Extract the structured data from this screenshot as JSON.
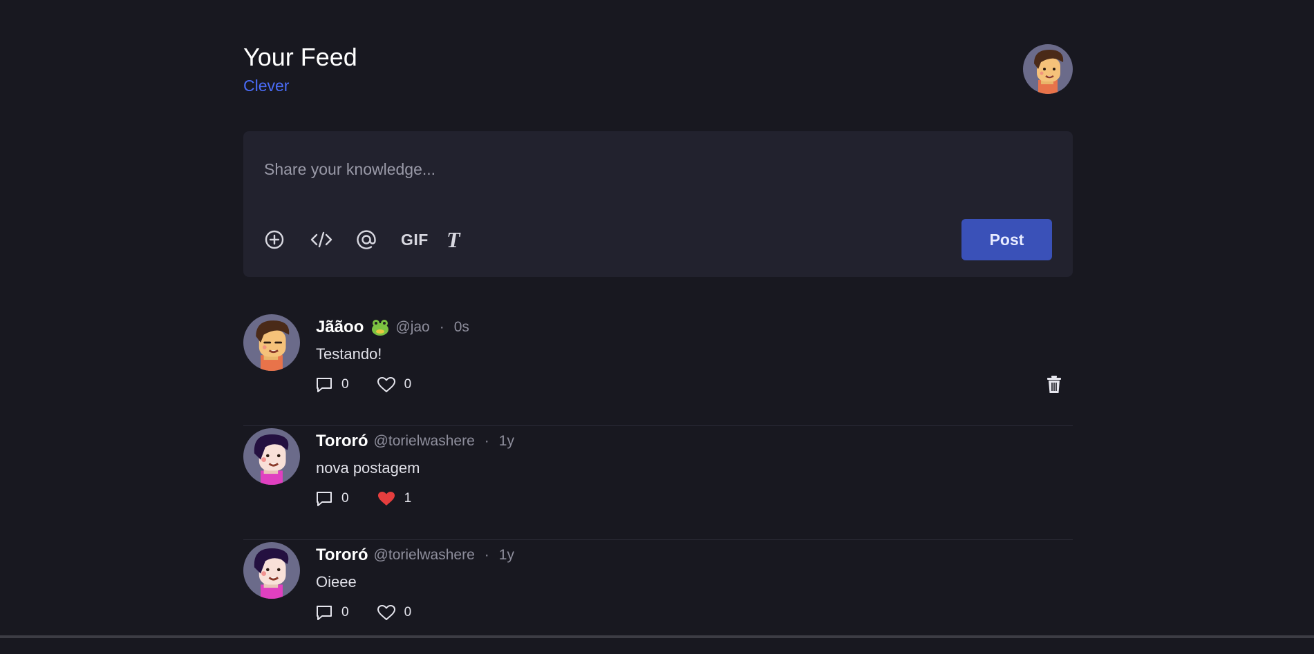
{
  "header": {
    "title": "Your Feed",
    "subtitle": "Clever",
    "avatar": "user-avatar-icon"
  },
  "composer": {
    "placeholder": "Share your knowledge...",
    "tools": [
      {
        "icon": "add-circle-icon"
      },
      {
        "icon": "code-icon"
      },
      {
        "icon": "mention-at-icon"
      },
      {
        "icon": "gif-icon",
        "label": "GIF"
      },
      {
        "icon": "text-format-icon",
        "label": "T"
      }
    ],
    "post_label": "Post"
  },
  "posts": [
    {
      "author": "Jããoo",
      "badge": "frog-icon",
      "handle": "@jao",
      "separator": "·",
      "time": "0s",
      "body": "Testando!",
      "comments": "0",
      "likes": "0",
      "liked": false,
      "deletable": true
    },
    {
      "author": "Tororó",
      "handle": "@torielwashere",
      "separator": "·",
      "time": "1y",
      "body": "nova postagem",
      "comments": "0",
      "likes": "1",
      "liked": true,
      "deletable": false
    },
    {
      "author": "Tororó",
      "handle": "@torielwashere",
      "separator": "·",
      "time": "1y",
      "body": "Oieee",
      "comments": "0",
      "likes": "0",
      "liked": false,
      "deletable": false
    }
  ],
  "colors": {
    "background": "#181820",
    "card": "#22222e",
    "accent": "#4a6cf7",
    "button": "#3a51b8",
    "like_active": "#e53e3e"
  }
}
